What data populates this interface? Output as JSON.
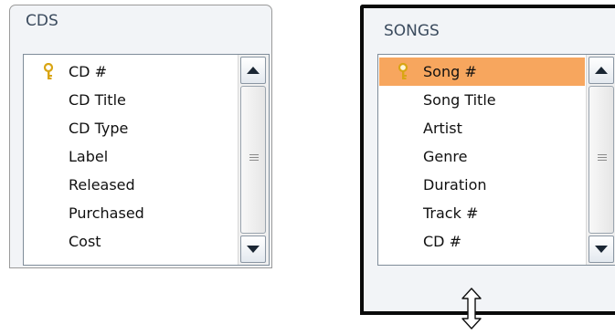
{
  "tables": [
    {
      "title": "CDS",
      "fields": [
        {
          "name": "CD #",
          "is_key": true
        },
        {
          "name": "CD Title",
          "is_key": false
        },
        {
          "name": "CD Type",
          "is_key": false
        },
        {
          "name": "Label",
          "is_key": false
        },
        {
          "name": "Released",
          "is_key": false
        },
        {
          "name": "Purchased",
          "is_key": false
        },
        {
          "name": "Cost",
          "is_key": false
        }
      ]
    },
    {
      "title": "SONGS",
      "selected": true,
      "fields": [
        {
          "name": "Song #",
          "is_key": true,
          "highlighted": true
        },
        {
          "name": "Song Title",
          "is_key": false
        },
        {
          "name": "Artist",
          "is_key": false
        },
        {
          "name": "Genre",
          "is_key": false
        },
        {
          "name": "Duration",
          "is_key": false
        },
        {
          "name": "Track #",
          "is_key": false
        },
        {
          "name": "CD #",
          "is_key": false
        }
      ]
    }
  ],
  "colors": {
    "highlight": "#f7a65e",
    "title_text": "#3b4b5e",
    "selection_border": "#0a0a0a",
    "key_icon": "#d9a514"
  },
  "icons": [
    "primary-key-icon",
    "scroll-up-arrow-icon",
    "scroll-down-arrow-icon",
    "thumb-grip-icon",
    "vertical-resize-cursor-icon"
  ]
}
